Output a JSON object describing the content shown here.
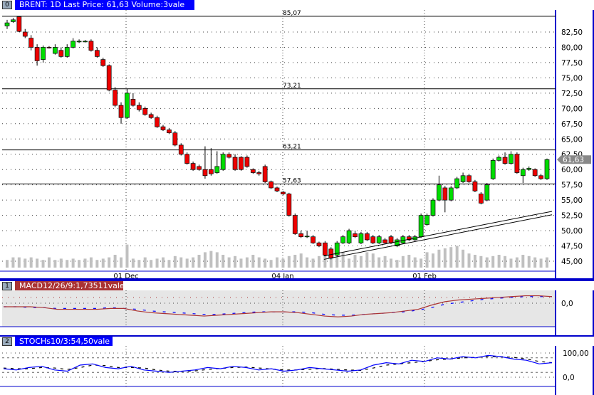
{
  "main": {
    "index": "0",
    "title": "BRENT: 1D Last Price: 61,63 Volume:3vale",
    "last_price": "61,63",
    "y_ticks": [
      "82,50",
      "80,00",
      "77,50",
      "75,00",
      "72,50",
      "70,00",
      "67,50",
      "65,00",
      "62,50",
      "60,00",
      "57,50",
      "55,00",
      "52,50",
      "50,00",
      "47,50",
      "45,00"
    ],
    "levels": [
      "85,07",
      "73,21",
      "63,21",
      "57,63"
    ],
    "dates": [
      "01 Dec",
      "04 Jan",
      "01 Feb"
    ],
    "candles": [
      [
        83.5,
        84.5,
        83,
        84
      ],
      [
        84.2,
        84.8,
        84,
        84.5
      ],
      [
        85,
        85.1,
        82.5,
        82.6
      ],
      [
        82.5,
        83,
        81.5,
        81.8
      ],
      [
        81.5,
        82,
        79.5,
        80
      ],
      [
        80,
        80.5,
        77,
        77.8
      ],
      [
        78,
        80.3,
        77.5,
        80
      ],
      [
        80,
        80.2,
        79.8,
        79.9
      ],
      [
        79,
        80.5,
        78.8,
        80
      ],
      [
        79.5,
        80,
        78.3,
        78.5
      ],
      [
        78.5,
        80.5,
        78.3,
        80
      ],
      [
        80,
        81.5,
        79.8,
        81
      ],
      [
        81,
        81.3,
        80.7,
        81
      ],
      [
        81,
        81.2,
        80.8,
        81
      ],
      [
        81,
        81.3,
        79.3,
        79.5
      ],
      [
        79.5,
        80,
        78.3,
        78.5
      ],
      [
        78,
        78.3,
        76.8,
        77
      ],
      [
        77,
        77.2,
        72.8,
        73
      ],
      [
        73,
        73.5,
        70.2,
        70.5
      ],
      [
        70.5,
        71,
        67.5,
        68.5
      ],
      [
        68.5,
        73.2,
        68.3,
        72.5
      ],
      [
        71.5,
        72.5,
        70.3,
        70.5
      ],
      [
        70.5,
        71,
        69.5,
        69.8
      ],
      [
        70,
        70.3,
        68.8,
        69
      ],
      [
        69,
        69.3,
        68.3,
        68.5
      ],
      [
        68.5,
        68.8,
        66.8,
        67
      ],
      [
        67,
        67.3,
        66.3,
        66.5
      ],
      [
        66.5,
        66.8,
        65.8,
        66
      ],
      [
        66,
        66.3,
        63.8,
        64
      ],
      [
        64,
        64.3,
        62.3,
        62.5
      ],
      [
        62.5,
        62.8,
        60.8,
        61
      ],
      [
        61,
        61.3,
        59.8,
        60
      ],
      [
        60.5,
        60.8,
        59.8,
        60
      ],
      [
        60,
        63.8,
        58.5,
        59
      ],
      [
        60,
        63.5,
        59,
        59.3
      ],
      [
        59.5,
        63,
        59.3,
        60.5
      ],
      [
        60,
        62.8,
        59.8,
        62.5
      ],
      [
        62.5,
        62.8,
        61.8,
        62
      ],
      [
        62,
        62.5,
        59.8,
        60
      ],
      [
        62,
        62.2,
        59.8,
        60
      ],
      [
        62,
        62.3,
        60.3,
        60.5
      ],
      [
        60,
        60.2,
        59.3,
        59.5
      ],
      [
        59.5,
        59.8,
        59,
        59.3
      ],
      [
        60.5,
        60.8,
        57.8,
        58
      ],
      [
        58,
        58.2,
        56.8,
        57
      ],
      [
        57,
        57.2,
        56.3,
        56.5
      ],
      [
        56.3,
        56.5,
        55.8,
        56
      ],
      [
        56,
        56.2,
        52.3,
        52.5
      ],
      [
        52.5,
        52.8,
        49.3,
        49.5
      ],
      [
        49.5,
        50,
        48.8,
        49
      ],
      [
        49,
        50,
        48.8,
        49.1
      ],
      [
        49,
        49.3,
        47.8,
        48
      ],
      [
        48,
        48.2,
        47.3,
        47.5
      ],
      [
        48,
        48.3,
        45.8,
        46
      ],
      [
        47,
        47.3,
        45.3,
        45.5
      ],
      [
        46,
        48.3,
        45.8,
        48
      ],
      [
        48,
        49.3,
        47.8,
        49
      ],
      [
        48,
        50.3,
        47.8,
        50
      ],
      [
        49.5,
        50,
        48.8,
        49
      ],
      [
        48,
        49.8,
        47.8,
        49.5
      ],
      [
        49.5,
        49.8,
        48.3,
        48.5
      ],
      [
        49,
        49.3,
        47.8,
        48
      ],
      [
        48,
        49.3,
        47.8,
        49
      ],
      [
        48.5,
        48.8,
        47.8,
        48
      ],
      [
        49,
        49.3,
        47.8,
        48
      ],
      [
        47.5,
        48.8,
        47.3,
        48.5
      ],
      [
        48,
        49.3,
        47.8,
        49
      ],
      [
        49,
        49.3,
        48.3,
        48.5
      ],
      [
        48.5,
        49.3,
        48.3,
        49
      ],
      [
        49,
        52.8,
        48.8,
        52.5
      ],
      [
        51,
        52.8,
        50.8,
        52.5
      ],
      [
        52.5,
        55.3,
        52.3,
        55
      ],
      [
        55,
        59,
        54.8,
        57.5
      ],
      [
        57,
        57.3,
        53,
        55
      ],
      [
        55,
        57.3,
        54.8,
        57
      ],
      [
        57,
        58.8,
        56.8,
        58.5
      ],
      [
        58,
        59.5,
        57.8,
        59
      ],
      [
        59,
        59.3,
        57.8,
        58
      ],
      [
        58,
        58.3,
        56.3,
        56.5
      ],
      [
        56,
        56.3,
        54.3,
        54.5
      ],
      [
        55,
        57.8,
        54.8,
        57.5
      ],
      [
        58.5,
        61.8,
        58.3,
        61.5
      ],
      [
        61.5,
        62.3,
        61.3,
        62
      ],
      [
        62,
        62.8,
        60.8,
        61
      ],
      [
        61,
        63,
        60.8,
        62.5
      ],
      [
        62.5,
        62.8,
        59.3,
        59.5
      ],
      [
        59,
        60.3,
        57.8,
        60
      ],
      [
        60,
        60.5,
        59.8,
        60.2
      ],
      [
        60,
        60.2,
        58.8,
        59
      ],
      [
        59,
        59.3,
        58.3,
        58.5
      ],
      [
        58.5,
        61.8,
        58.3,
        61.63
      ]
    ],
    "volume": [
      0.3,
      0.4,
      0.4,
      0.35,
      0.4,
      0.35,
      0.3,
      0.4,
      0.3,
      0.35,
      0.3,
      0.35,
      0.3,
      0.35,
      0.4,
      0.3,
      0.35,
      0.4,
      0.5,
      0.4,
      0.9,
      0.35,
      0.3,
      0.4,
      0.3,
      0.35,
      0.4,
      0.3,
      0.45,
      0.4,
      0.35,
      0.4,
      0.5,
      0.6,
      0.65,
      0.6,
      0.5,
      0.4,
      0.45,
      0.35,
      0.4,
      0.5,
      0.4,
      0.35,
      0.3,
      0.4,
      0.35,
      0.45,
      0.5,
      0.55,
      0.4,
      0.35,
      0.45,
      0.5,
      0.4,
      0.55,
      0.6,
      0.35,
      0.5,
      0.45,
      0.6,
      0.55,
      0.4,
      0.45,
      0.35,
      0.3,
      0.45,
      0.5,
      0.4,
      0.35,
      0.6,
      0.55,
      0.7,
      0.75,
      0.8,
      0.85,
      0.7,
      0.55,
      0.5,
      0.45,
      0.4,
      0.45,
      0.5,
      0.45,
      0.35,
      0.4,
      0.5,
      0.45,
      0.4,
      0.35,
      0.4
    ],
    "trendline": {
      "from": [
        54,
        45.3
      ],
      "to": [
        90,
        52.6
      ]
    }
  },
  "macd": {
    "index": "1",
    "title": "MACD12/26/9:1,73511vale",
    "zero_label": "0,0",
    "macd": [
      0,
      0,
      0,
      -0.1,
      -0.3,
      -0.3,
      -0.3,
      -0.3,
      -0.2,
      -0.2,
      -0.5,
      -0.7,
      -0.8,
      -0.9,
      -1,
      -1.1,
      -1,
      -0.9,
      -0.8,
      -0.7,
      -0.6,
      -0.6,
      -0.7,
      -0.9,
      -1.1,
      -1.2,
      -1.1,
      -0.9,
      -0.8,
      -0.7,
      -0.5,
      -0.3,
      0.2,
      0.6,
      0.8,
      0.9,
      1,
      1.1,
      1.2,
      1.3,
      1.3,
      1.2
    ],
    "signal": [
      0,
      0,
      -0.1,
      -0.1,
      -0.2,
      -0.2,
      -0.2,
      -0.2,
      -0.1,
      -0.2,
      -0.3,
      -0.5,
      -0.6,
      -0.7,
      -0.8,
      -0.9,
      -0.9,
      -0.8,
      -0.7,
      -0.6,
      -0.6,
      -0.6,
      -0.6,
      -0.7,
      -0.9,
      -1,
      -1,
      -0.9,
      -0.8,
      -0.7,
      -0.6,
      -0.4,
      -0.1,
      0.3,
      0.5,
      0.7,
      0.9,
      1,
      1.1,
      1.2,
      1.2,
      1.2
    ]
  },
  "stoch": {
    "index": "2",
    "title": "STOCHs10/3:54,50vale",
    "ticks": [
      "100,00",
      "0,0"
    ],
    "k": [
      35,
      30,
      40,
      45,
      30,
      25,
      50,
      55,
      40,
      35,
      45,
      30,
      25,
      20,
      25,
      30,
      40,
      35,
      45,
      40,
      30,
      35,
      25,
      30,
      40,
      35,
      30,
      25,
      30,
      50,
      60,
      55,
      70,
      65,
      80,
      75,
      85,
      80,
      90,
      85,
      75,
      70,
      55,
      60
    ],
    "d": [
      38,
      35,
      35,
      40,
      38,
      32,
      40,
      50,
      48,
      40,
      40,
      38,
      30,
      25,
      24,
      26,
      32,
      36,
      40,
      42,
      38,
      34,
      30,
      30,
      33,
      36,
      33,
      30,
      28,
      38,
      50,
      55,
      60,
      65,
      72,
      75,
      80,
      82,
      85,
      85,
      82,
      75,
      65,
      60
    ]
  }
}
